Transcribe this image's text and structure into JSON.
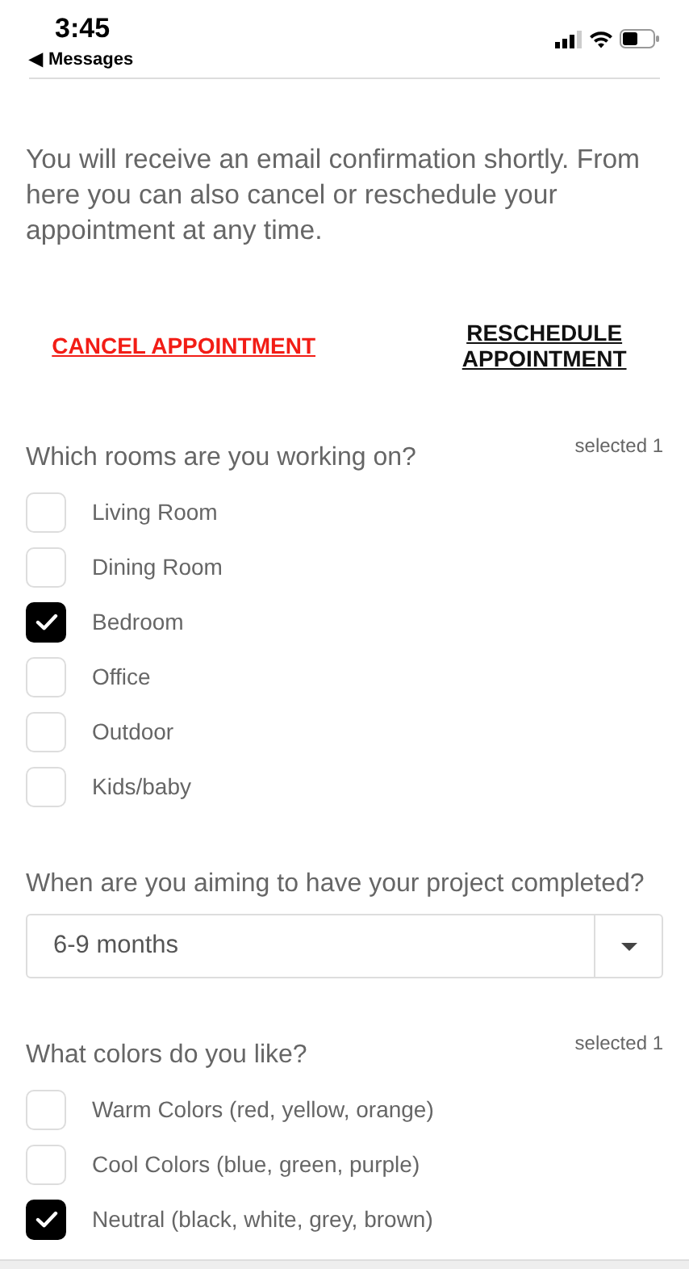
{
  "status_bar": {
    "time": "3:45",
    "back_arrow": "◀",
    "back_label": "Messages"
  },
  "intro": "You will receive an email confirmation shortly. From here you can also cancel or reschedule your appointment at any time.",
  "actions": [
    {
      "label": "CANCEL APPOINTMENT",
      "kind": "danger"
    },
    {
      "label": "RESCHEDULE APPOINTMENT",
      "kind": "plain"
    }
  ],
  "rooms": {
    "question": "Which rooms are you working on?",
    "count": "selected 1",
    "options": [
      {
        "label": "Living Room",
        "checked": false
      },
      {
        "label": "Dining Room",
        "checked": false
      },
      {
        "label": "Bedroom",
        "checked": true
      },
      {
        "label": "Office",
        "checked": false
      },
      {
        "label": "Outdoor",
        "checked": false
      },
      {
        "label": "Kids/baby",
        "checked": false
      }
    ]
  },
  "timeline": {
    "question": "When are you aiming to have your project completed?",
    "value": "6-9 months"
  },
  "colors": {
    "question": "What colors do you like?",
    "count": "selected 1",
    "options": [
      {
        "label": "Warm Colors (red, yellow, orange)",
        "checked": false
      },
      {
        "label": "Cool Colors (blue, green, purple)",
        "checked": false
      },
      {
        "label": "Neutral (black, white, grey, brown)",
        "checked": true
      }
    ]
  }
}
